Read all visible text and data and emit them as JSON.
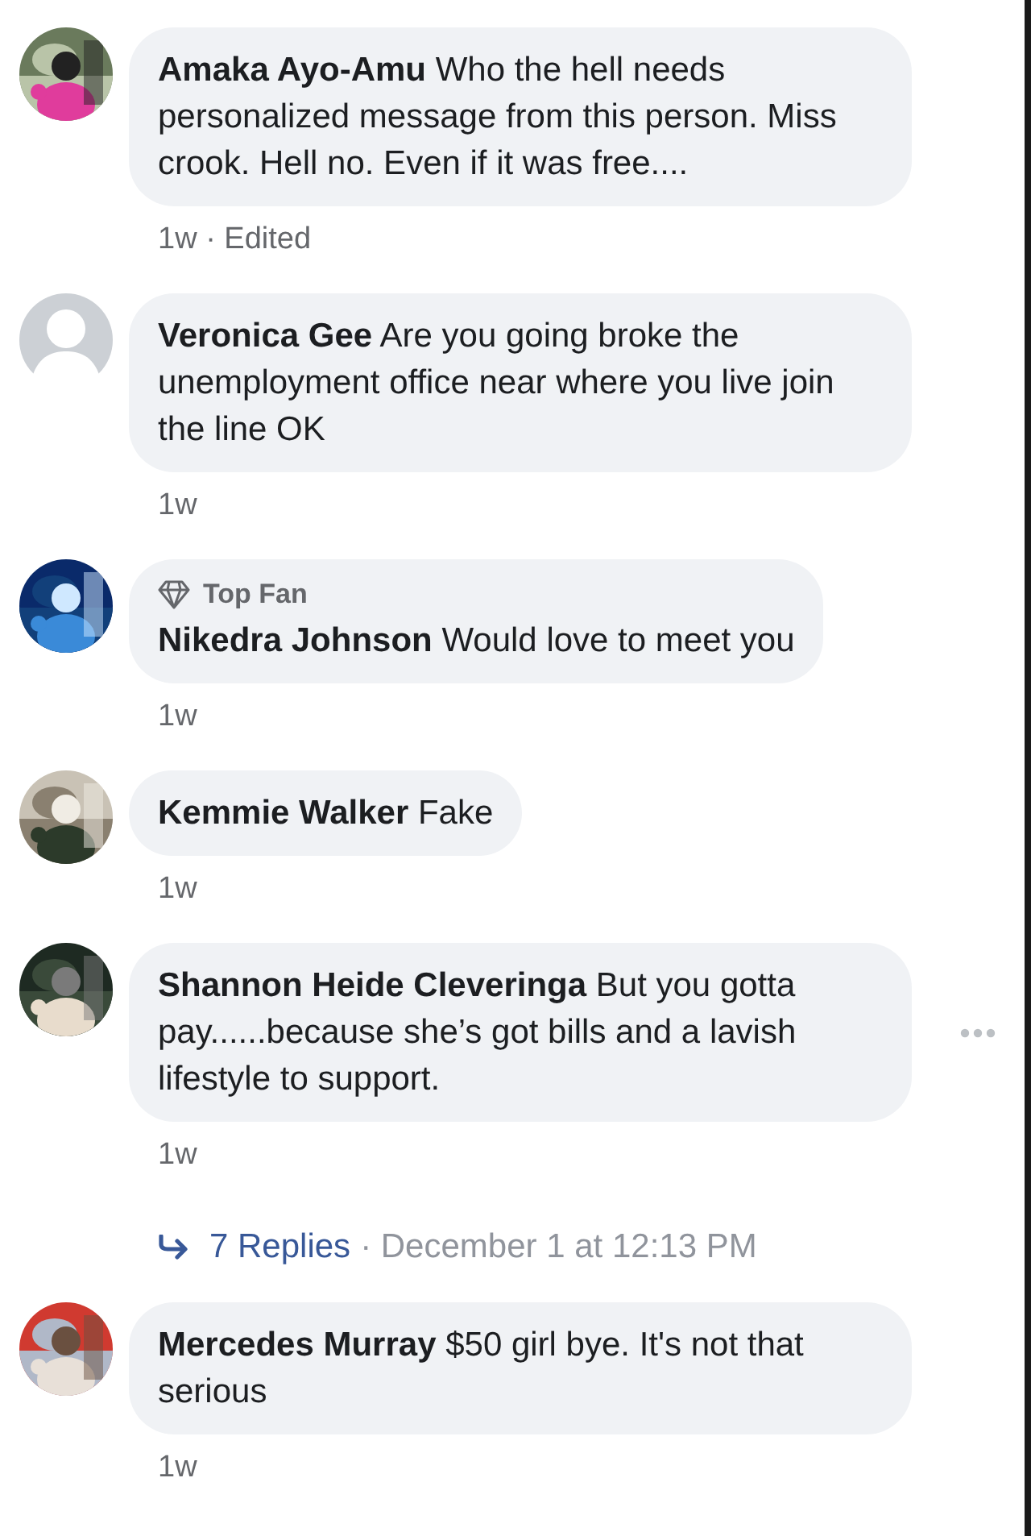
{
  "comments": [
    {
      "name": "Amaka Ayo-Amu",
      "text": "Who the hell needs personalized message from this person. Miss crook. Hell no. Even if it was free....",
      "meta": "1w · Edited",
      "menu_visible": false
    },
    {
      "avatar": {
        "kind": "default"
      },
      "name": "Veronica Gee",
      "text": "Are you going broke the unemployment office near where you live join the line OK",
      "meta": "1w",
      "menu_visible": false
    },
    {
      "badge": "Top Fan",
      "name": "Nikedra Johnson",
      "text": "Would love to meet you",
      "meta": "1w",
      "menu_visible": false
    },
    {
      "name": "Kemmie Walker",
      "text": "Fake",
      "meta": "1w",
      "menu_visible": false
    },
    {
      "name": "Shannon Heide Cleveringa",
      "text": "But you gotta pay......because she’s got bills and a lavish lifestyle to support.",
      "meta": "1w",
      "menu_visible": true,
      "replies": {
        "link": "7 Replies",
        "date": "· December 1 at 12:13 PM"
      }
    },
    {
      "name": "Mercedes Murray",
      "text": "$50 girl bye. It's not that serious",
      "meta": "1w",
      "menu_visible": false
    }
  ]
}
